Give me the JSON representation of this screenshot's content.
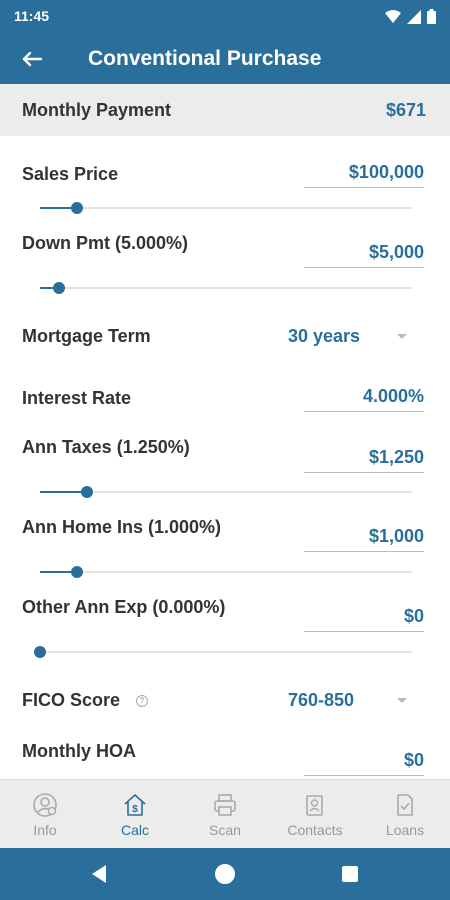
{
  "status_bar": {
    "time": "11:45"
  },
  "app_bar": {
    "title": "Conventional Purchase"
  },
  "monthly_payment": {
    "label": "Monthly Payment",
    "value": "$671"
  },
  "fields": {
    "sales_price": {
      "label": "Sales Price",
      "value": "$100,000",
      "slider_fraction": 0.1
    },
    "down_pmt": {
      "label": "Down Pmt (5.000%)",
      "value": "$5,000",
      "slider_fraction": 0.05
    },
    "mortgage_term": {
      "label": "Mortgage Term",
      "value": "30 years"
    },
    "interest_rate": {
      "label": "Interest Rate",
      "value": "4.000%"
    },
    "ann_taxes": {
      "label": "Ann Taxes (1.250%)",
      "value": "$1,250",
      "slider_fraction": 0.125
    },
    "ann_home_ins": {
      "label": "Ann Home Ins (1.000%)",
      "value": "$1,000",
      "slider_fraction": 0.1
    },
    "other_ann_exp": {
      "label": "Other Ann Exp (0.000%)",
      "value": "$0",
      "slider_fraction": 0.0
    },
    "fico_score": {
      "label": "FICO Score",
      "value": "760-850"
    },
    "monthly_hoa": {
      "label": "Monthly HOA",
      "value": "$0"
    }
  },
  "bottom_nav": {
    "items": [
      {
        "label": "Info",
        "icon": "person-info-icon",
        "active": false
      },
      {
        "label": "Calc",
        "icon": "house-dollar-icon",
        "active": true
      },
      {
        "label": "Scan",
        "icon": "printer-icon",
        "active": false
      },
      {
        "label": "Contacts",
        "icon": "contacts-icon",
        "active": false
      },
      {
        "label": "Loans",
        "icon": "document-check-icon",
        "active": false
      }
    ]
  },
  "colors": {
    "primary": "#2a6f9b",
    "inactive": "#999999",
    "panel": "#ececec"
  }
}
